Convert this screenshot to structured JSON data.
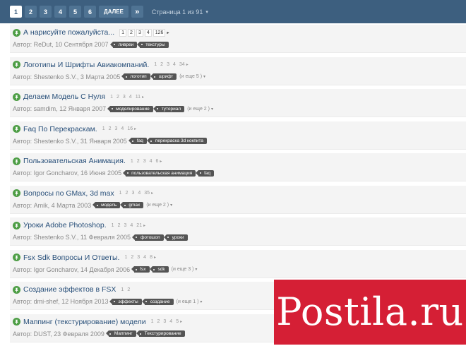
{
  "pagination": {
    "pages": [
      "1",
      "2",
      "3",
      "4",
      "5",
      "6"
    ],
    "active": "1",
    "next_label": "ДАЛЕЕ",
    "last_label": "»",
    "info": "Страница 1 из 91",
    "caret": "▾"
  },
  "topics": [
    {
      "title": "А нарисуйте пожалуйста...",
      "boxed": true,
      "pages": [
        "1",
        "2",
        "3",
        "4",
        "126"
      ],
      "arrow": "▸",
      "author": "Автор: ReDut, 10 Сентября 2007",
      "tags": [
        "ливреи",
        "текстуры"
      ],
      "more": ""
    },
    {
      "title": "Логотипы И Шрифты Авиакомпаний.",
      "boxed": false,
      "pages": [
        "1",
        "2",
        "3",
        "4",
        "34"
      ],
      "arrow": "▸",
      "author": "Автор: Shestenko S.V., 3 Марта 2005",
      "tags": [
        "логотип",
        "шрифт"
      ],
      "more": "(и еще 5 )"
    },
    {
      "title": "Делаем Модель С Нуля",
      "boxed": false,
      "pages": [
        "1",
        "2",
        "3",
        "4",
        "11"
      ],
      "arrow": "▸",
      "author": "Автор: samdim, 12 Января 2007",
      "tags": [
        "моделирование",
        "туториал"
      ],
      "more": "(и еще 2 )"
    },
    {
      "title": "Faq По Перекраскам.",
      "boxed": false,
      "pages": [
        "1",
        "2",
        "3",
        "4",
        "16"
      ],
      "arrow": "▸",
      "author": "Автор: Shestenko S.V., 31 Января 2005",
      "tags": [
        "faq",
        "перекраска 3d кокпита"
      ],
      "more": ""
    },
    {
      "title": "Пользовательская Анимация.",
      "boxed": false,
      "pages": [
        "1",
        "2",
        "3",
        "4",
        "6"
      ],
      "arrow": "▸",
      "author": "Автор: Igor Goncharov, 16 Июня 2005",
      "tags": [
        "пользовательская анимация",
        "faq"
      ],
      "more": ""
    },
    {
      "title": "Вопросы по GMax, 3d max",
      "boxed": false,
      "pages": [
        "1",
        "2",
        "3",
        "4",
        "35"
      ],
      "arrow": "▸",
      "author": "Автор: Amik, 4 Марта 2003",
      "tags": [
        "модель",
        "gmax"
      ],
      "more": "(и еще 2 )"
    },
    {
      "title": "Уроки Adobe Photoshop.",
      "boxed": false,
      "pages": [
        "1",
        "2",
        "3",
        "4",
        "21"
      ],
      "arrow": "▸",
      "author": "Автор: Shestenko S.V., 11 Февраля 2005",
      "tags": [
        "фотошоп",
        "уроки"
      ],
      "more": ""
    },
    {
      "title": "Fsx Sdk Вопросы И Ответы.",
      "boxed": false,
      "pages": [
        "1",
        "2",
        "3",
        "4",
        "8"
      ],
      "arrow": "▸",
      "author": "Автор: Igor Goncharov, 14 Декабря 2006",
      "tags": [
        "fsx",
        "sdk"
      ],
      "more": "(и еще 3 )"
    },
    {
      "title": "Создание эффектов в FSX",
      "boxed": false,
      "pages": [
        "1",
        "2"
      ],
      "arrow": "",
      "author": "Автор: dmi-shef, 12 Ноября 2013",
      "tags": [
        "эффекты",
        "создание"
      ],
      "more": "(и еще 1 )"
    },
    {
      "title": "Маппинг (текстурирование) модели",
      "boxed": false,
      "pages": [
        "1",
        "2",
        "3",
        "4",
        "5"
      ],
      "arrow": "▸",
      "author": "Автор: DUST, 23 Февраля 2009",
      "tags": [
        "Маппинг",
        "Текстурирование"
      ],
      "more": ""
    }
  ],
  "more_caret": "▾",
  "watermark": "Postila.ru"
}
